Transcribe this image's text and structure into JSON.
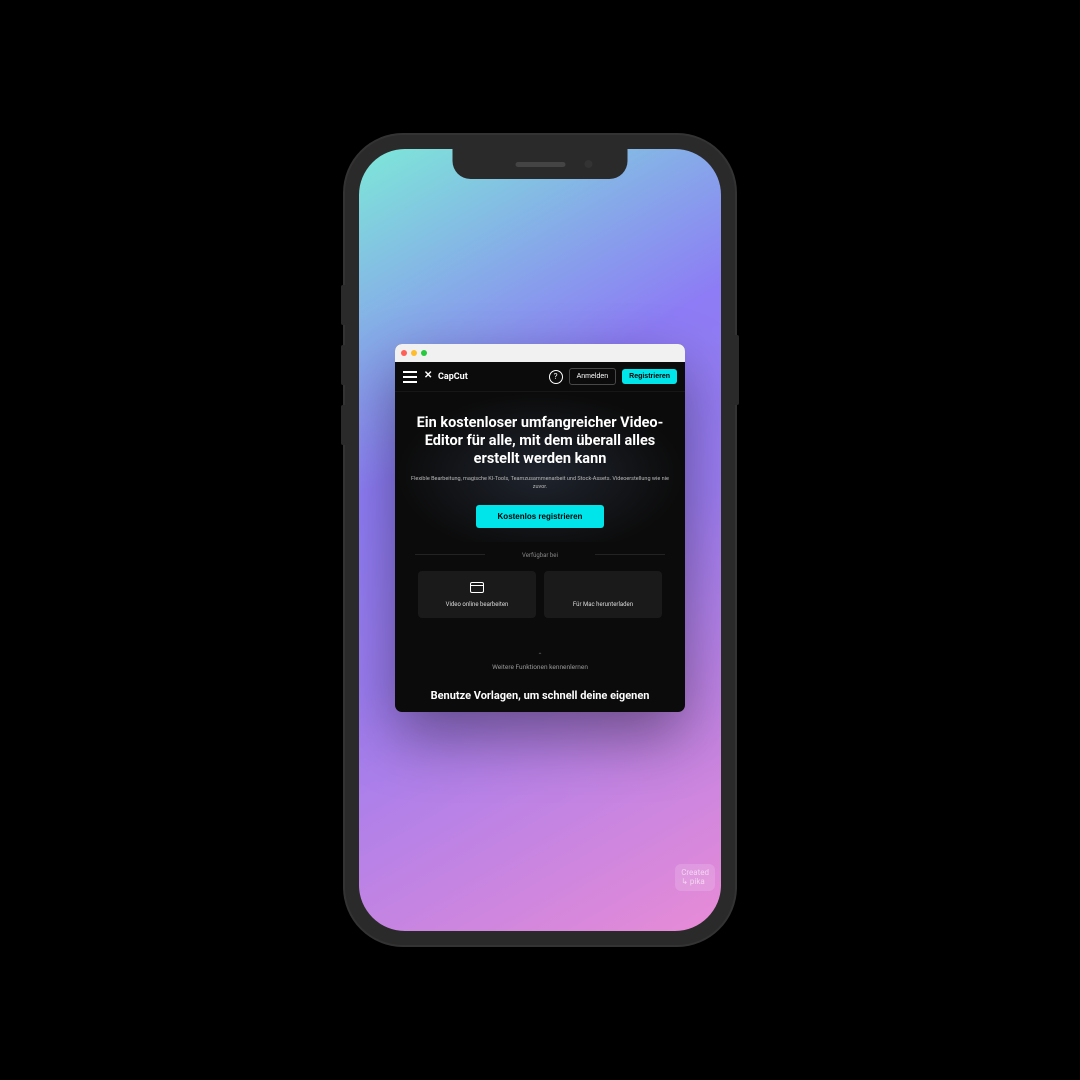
{
  "header": {
    "brand": "CapCut",
    "login": "Anmelden",
    "register": "Registrieren"
  },
  "hero": {
    "title": "Ein kostenloser umfangreicher Video-Editor für alle, mit dem überall alles erstellt werden kann",
    "subtitle": "Flexible Bearbeitung, magische KI-Tools, Teamzusammenarbeit und Stock-Assets. Videoerstellung wie nie zuvor.",
    "cta": "Kostenlos registrieren"
  },
  "available_label": "Verfügbar bei",
  "cards": {
    "online": "Video online bearbeiten",
    "mac": "Für Mac herunterladen"
  },
  "learn_more": "Weitere Funktionen kennenlernen",
  "templates_heading": "Benutze Vorlagen, um schnell deine eigenen",
  "watermark_line1": "Created",
  "watermark_line2": "pika"
}
